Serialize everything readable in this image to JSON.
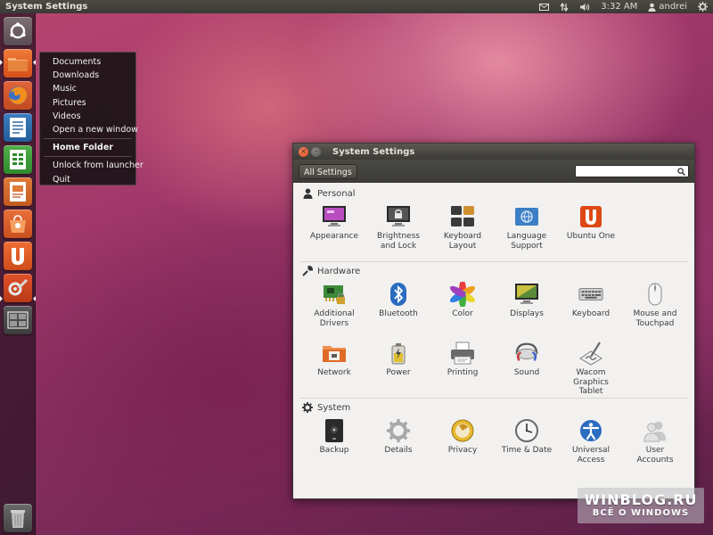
{
  "top_panel": {
    "title": "System Settings",
    "time": "3:32 AM",
    "user": "andrei",
    "icons": [
      "mail-icon",
      "network-arrows-icon",
      "volume-icon",
      "user-icon",
      "power-gear-icon"
    ]
  },
  "launcher": {
    "items": [
      {
        "name": "dash-home",
        "icon": "ubuntu-logo-icon",
        "color": "#6a5a60"
      },
      {
        "name": "home-folder",
        "icon": "folder-icon",
        "color": "#e5631e"
      },
      {
        "name": "firefox",
        "icon": "firefox-icon",
        "color": "#d8562a"
      },
      {
        "name": "libreoffice-writer",
        "icon": "writer-icon",
        "color": "#2b6aa8"
      },
      {
        "name": "libreoffice-calc",
        "icon": "calc-icon",
        "color": "#3a9a3a"
      },
      {
        "name": "libreoffice-impress",
        "icon": "impress-icon",
        "color": "#d06420"
      },
      {
        "name": "software-center",
        "icon": "software-center-icon",
        "color": "#d8562a"
      },
      {
        "name": "ubuntu-one",
        "icon": "ubuntu-one-icon",
        "color": "#e05a20"
      },
      {
        "name": "system-settings",
        "icon": "settings-wrench-icon",
        "color": "#c8401e"
      },
      {
        "name": "workspace-switcher",
        "icon": "workspaces-icon",
        "color": "#4a4a4a"
      },
      {
        "name": "trash",
        "icon": "trash-icon",
        "color": "#5a5a5a"
      }
    ]
  },
  "quicklist": {
    "items": [
      "Documents",
      "Downloads",
      "Music",
      "Pictures",
      "Videos",
      "Open a new window"
    ],
    "header": "Home Folder",
    "actions": [
      "Unlock from launcher",
      "Quit"
    ]
  },
  "window": {
    "title": "System Settings",
    "all_settings_label": "All Settings",
    "search_placeholder": "",
    "sections": [
      {
        "title": "Personal",
        "icon": "person-icon",
        "items": [
          {
            "label": "Appearance",
            "icon": "appearance-icon"
          },
          {
            "label": "Brightness\nand Lock",
            "icon": "brightness-lock-icon"
          },
          {
            "label": "Keyboard\nLayout",
            "icon": "keyboard-layout-icon"
          },
          {
            "label": "Language\nSupport",
            "icon": "language-support-icon"
          },
          {
            "label": "Ubuntu One",
            "icon": "ubuntu-one-icon"
          }
        ]
      },
      {
        "title": "Hardware",
        "icon": "wrench-icon",
        "items": [
          {
            "label": "Additional\nDrivers",
            "icon": "additional-drivers-icon"
          },
          {
            "label": "Bluetooth",
            "icon": "bluetooth-icon"
          },
          {
            "label": "Color",
            "icon": "color-icon"
          },
          {
            "label": "Displays",
            "icon": "displays-icon"
          },
          {
            "label": "Keyboard",
            "icon": "keyboard-icon"
          },
          {
            "label": "Mouse and\nTouchpad",
            "icon": "mouse-icon"
          },
          {
            "label": "Network",
            "icon": "network-icon"
          },
          {
            "label": "Power",
            "icon": "power-icon"
          },
          {
            "label": "Printing",
            "icon": "printer-icon"
          },
          {
            "label": "Sound",
            "icon": "sound-icon"
          },
          {
            "label": "Wacom\nGraphics\nTablet",
            "icon": "wacom-tablet-icon"
          }
        ]
      },
      {
        "title": "System",
        "icon": "gear-icon",
        "items": [
          {
            "label": "Backup",
            "icon": "backup-icon"
          },
          {
            "label": "Details",
            "icon": "details-gear-icon"
          },
          {
            "label": "Privacy",
            "icon": "privacy-icon"
          },
          {
            "label": "Time & Date",
            "icon": "clock-icon"
          },
          {
            "label": "Universal\nAccess",
            "icon": "universal-access-icon"
          },
          {
            "label": "User\nAccounts",
            "icon": "user-accounts-icon"
          }
        ]
      }
    ]
  },
  "watermark": {
    "main": "WINBLOG.RU",
    "sub": "ВСЁ О WINDOWS"
  },
  "colors": {
    "accent": "#dd4814",
    "panel": "#3c3b37",
    "window_bg": "#f2f1f0"
  }
}
